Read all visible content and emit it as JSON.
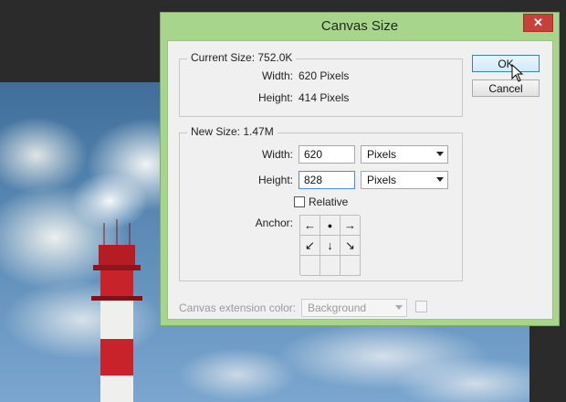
{
  "dialog": {
    "title": "Canvas Size",
    "close_glyph": "✕"
  },
  "current_size": {
    "legend": "Current Size: 752.0K",
    "width_label": "Width:",
    "width_value": "620 Pixels",
    "height_label": "Height:",
    "height_value": "414 Pixels"
  },
  "new_size": {
    "legend": "New Size: 1.47M",
    "width_label": "Width:",
    "width_value": "620",
    "width_unit": "Pixels",
    "height_label": "Height:",
    "height_value": "828",
    "height_unit": "Pixels",
    "relative_label": "Relative",
    "relative_checked": false,
    "anchor_label": "Anchor:",
    "anchor_cells": [
      "arrow-left",
      "dot",
      "arrow-right",
      "arrow-down-left",
      "arrow-down",
      "arrow-down-right",
      "blank",
      "blank",
      "blank"
    ],
    "anchor_glyphs": {
      "arrow-left": "←",
      "dot": "●",
      "arrow-right": "→",
      "arrow-down-left": "↙",
      "arrow-down": "↓",
      "arrow-down-right": "↘",
      "blank": ""
    }
  },
  "extension": {
    "label": "Canvas extension color:",
    "value": "Background"
  },
  "buttons": {
    "ok": "OK",
    "cancel": "Cancel"
  },
  "colors": {
    "dialog_frame": "#a7d58b",
    "close_button": "#c7413a",
    "focus_border": "#4a8cd9"
  }
}
